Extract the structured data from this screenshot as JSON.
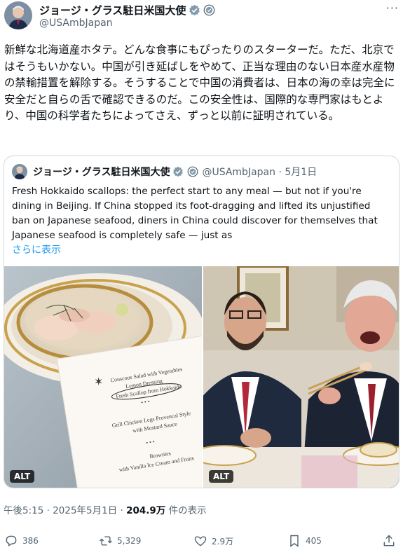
{
  "tweet": {
    "display_name": "ジョージ・グラス駐日米国大使",
    "handle": "@USAmbJapan",
    "more": "···",
    "body": "新鮮な北海道産ホタテ。どんな食事にもぴったりのスターターだ。ただ、北京ではそうもいかない。中国が引き延ばしをやめて、正当な理由のない日本産水産物の禁輸措置を解除する。そうすることで中国の消費者は、日本の海の幸は完全に安全だと自らの舌で確認できるのだ。この安全性は、国際的な専門家はもとより、中国の科学者たちによってさえ、ずっと以前に証明されている。"
  },
  "quote": {
    "display_name": "ジョージ・グラス駐日米国大使",
    "handle_date": "@USAmbJapan · 5月1日",
    "text": "Fresh Hokkaido scallops: the perfect start to any meal — but not if you're dining in Beijing. If China stopped its foot-dragging and lifted its unjustified ban on Japanese seafood, diners in China could discover for themselves that Japanese seafood is completely safe — just as",
    "show_more": "さらに表示",
    "alt_label": "ALT",
    "menu": [
      "Couscous Salad with Vegetables",
      "Lemon Dressing",
      "Fresh Scallop from Hokkaido",
      "Grill Chicken Legs Provencal Style",
      "with Mustard Sauce",
      "Brownies",
      "with Vanilla Ice Cream and Fruits"
    ]
  },
  "meta": {
    "time": "午後5:15 · 2025年5月1日 · ",
    "views": "204.9万",
    "views_suffix": " 件の表示"
  },
  "actions": {
    "reply": "386",
    "retweet": "5,329",
    "like": "2.9万",
    "bookmark": "405"
  },
  "colors": {
    "verified_gray": "#829aab",
    "link_blue": "#1d9bf0",
    "text_secondary": "#536471"
  }
}
